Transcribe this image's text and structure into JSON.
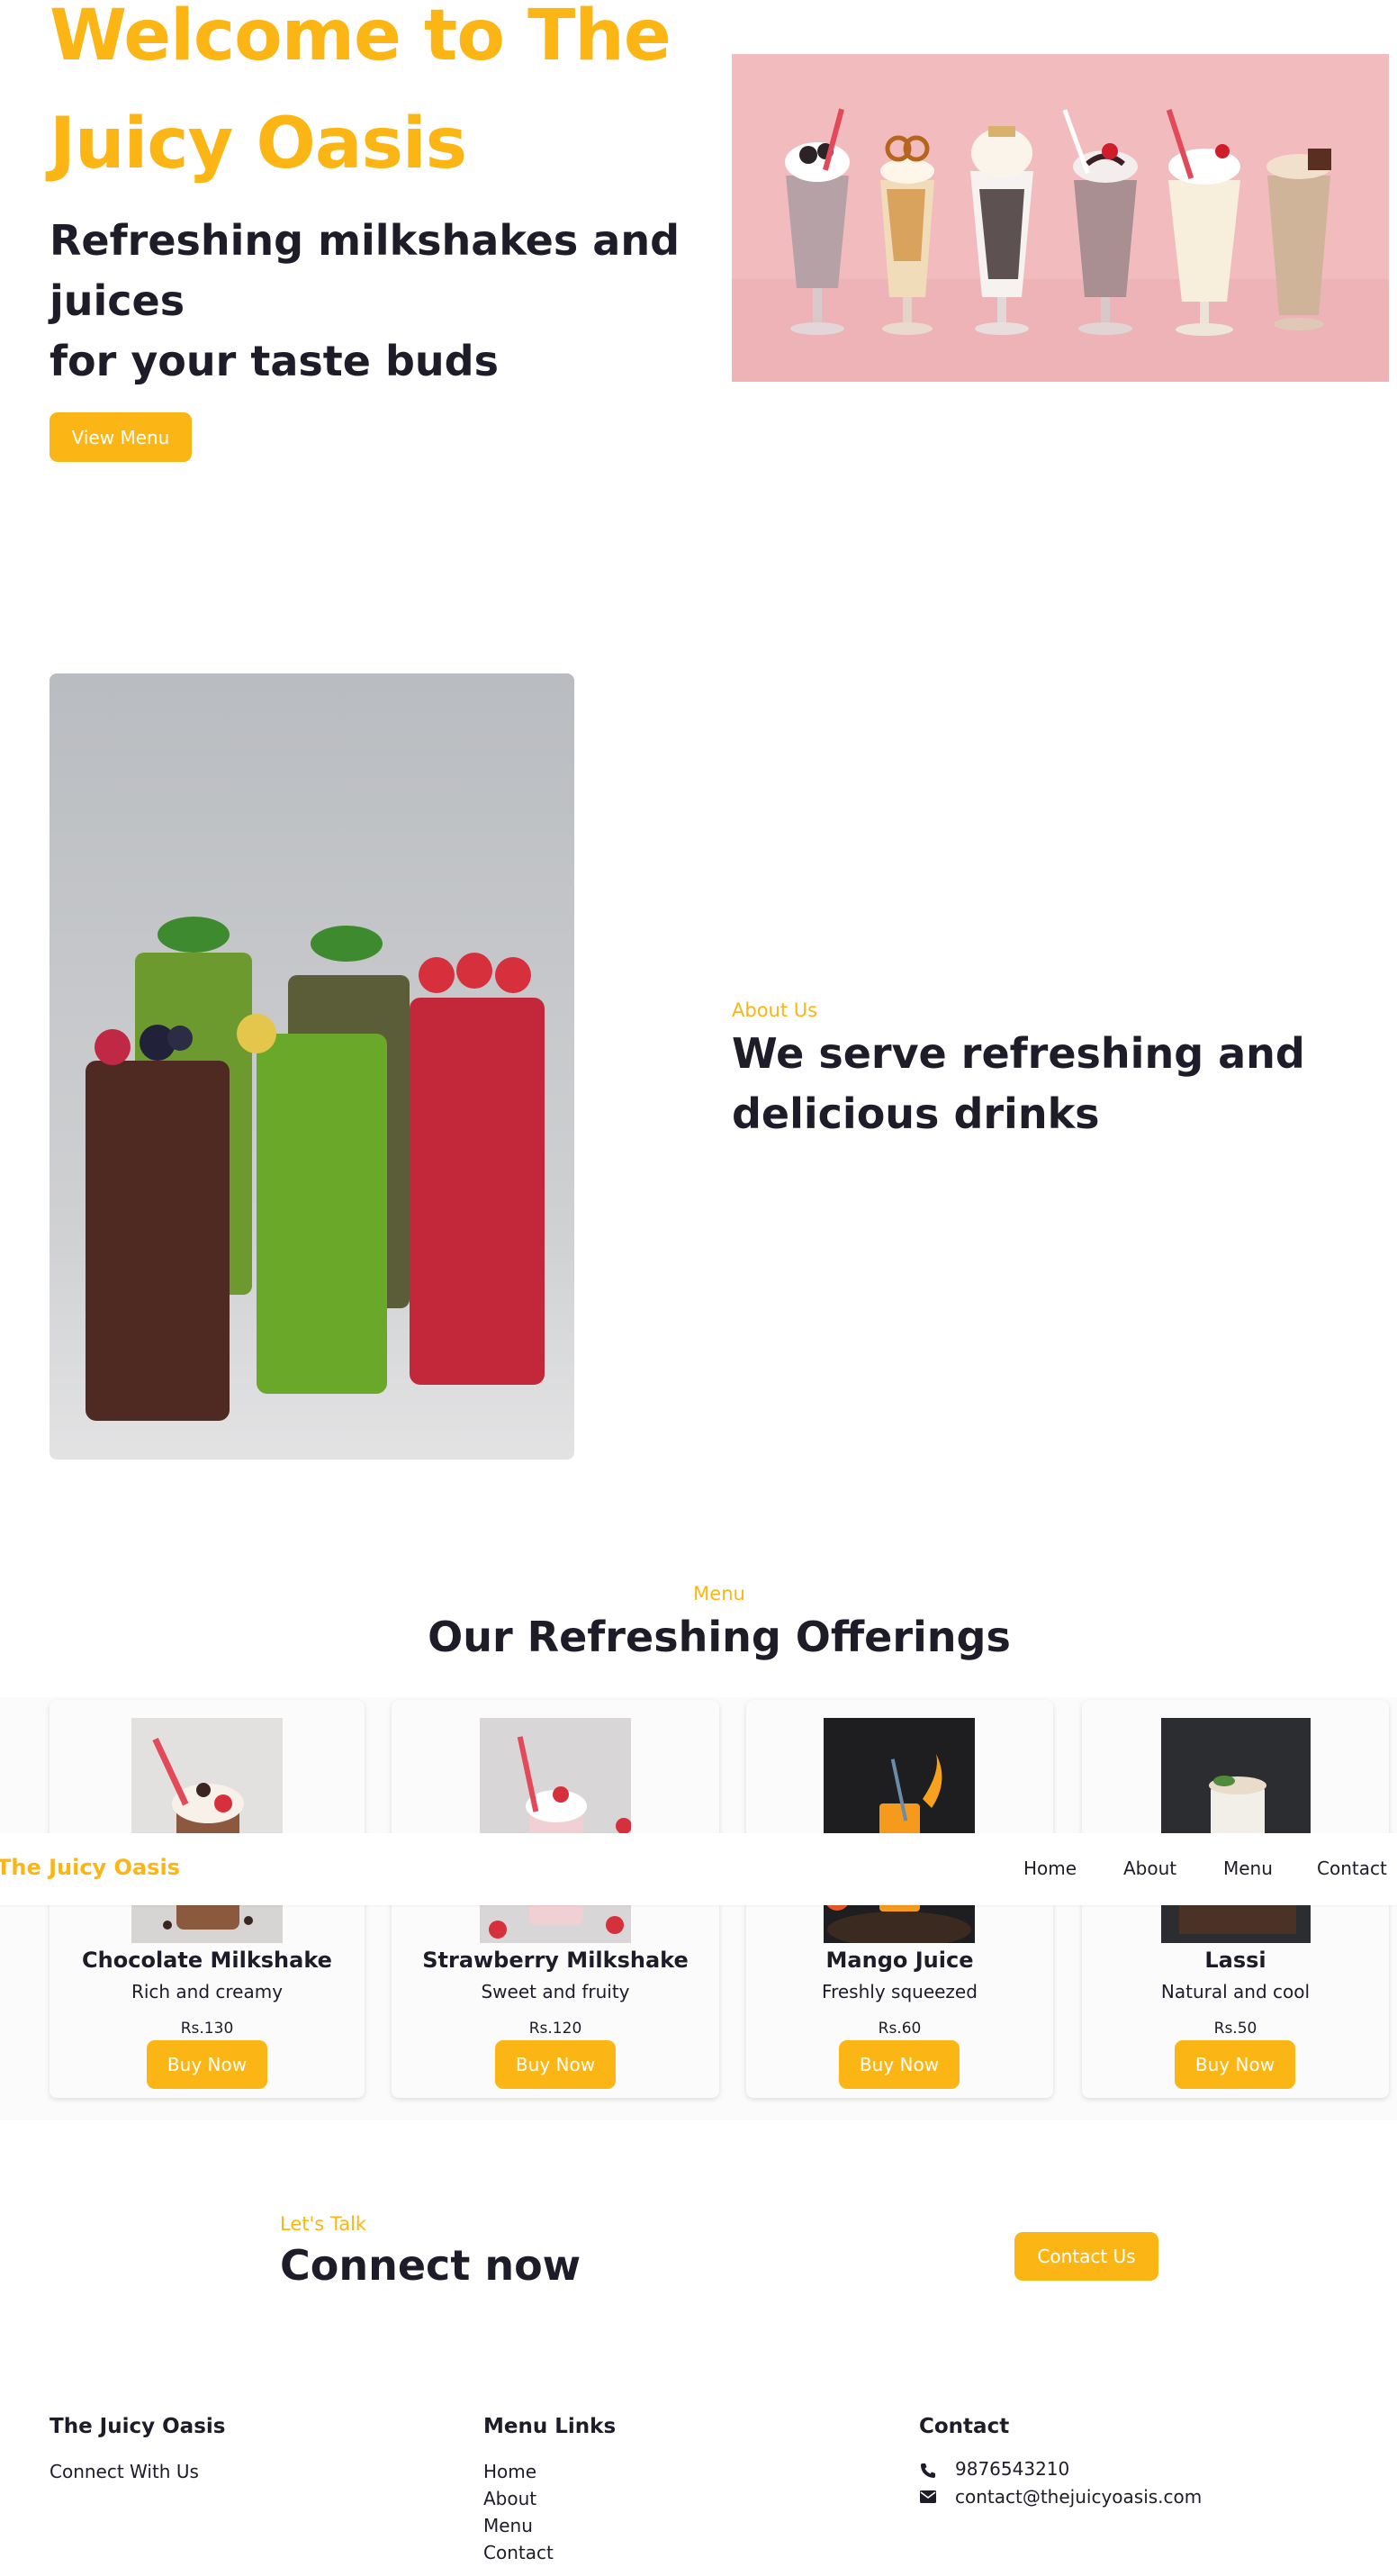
{
  "hero": {
    "title": "Welcome to The Juicy Oasis",
    "subtitle_line1": "Refreshing milkshakes and juices",
    "subtitle_line2": "for your taste buds",
    "button": "View Menu"
  },
  "about": {
    "eyebrow": "About Us",
    "title": "We serve refreshing and delicious drinks"
  },
  "menu": {
    "eyebrow": "Menu",
    "title": "Our Refreshing Offerings",
    "items": [
      {
        "name": "Chocolate Milkshake",
        "description": "Rich and creamy",
        "price": "Rs.130",
        "button": "Buy Now"
      },
      {
        "name": "Strawberry Milkshake",
        "description": "Sweet and fruity",
        "price": "Rs.120",
        "button": "Buy Now"
      },
      {
        "name": "Mango Juice",
        "description": "Freshly squeezed",
        "price": "Rs.60",
        "button": "Buy Now"
      },
      {
        "name": "Lassi",
        "description": "Natural and cool",
        "price": "Rs.50",
        "button": "Buy Now"
      }
    ]
  },
  "navbar": {
    "brand": "The Juicy Oasis",
    "links": [
      "Home",
      "About",
      "Menu",
      "Contact"
    ]
  },
  "connect": {
    "eyebrow": "Let's Talk",
    "title": "Connect now",
    "button": "Contact Us"
  },
  "footer": {
    "col1": {
      "heading": "The Juicy Oasis",
      "text": "Connect With Us"
    },
    "col2": {
      "heading": "Menu Links",
      "links": [
        "Home",
        "About",
        "Menu",
        "Contact"
      ]
    },
    "col3": {
      "heading": "Contact",
      "phone": "9876543210",
      "email": "contact@thejuicyoasis.com"
    }
  },
  "colors": {
    "accent": "#fbb615",
    "text": "#1d1c28"
  },
  "icons": {
    "phone": "phone-icon",
    "email": "envelope-icon"
  }
}
